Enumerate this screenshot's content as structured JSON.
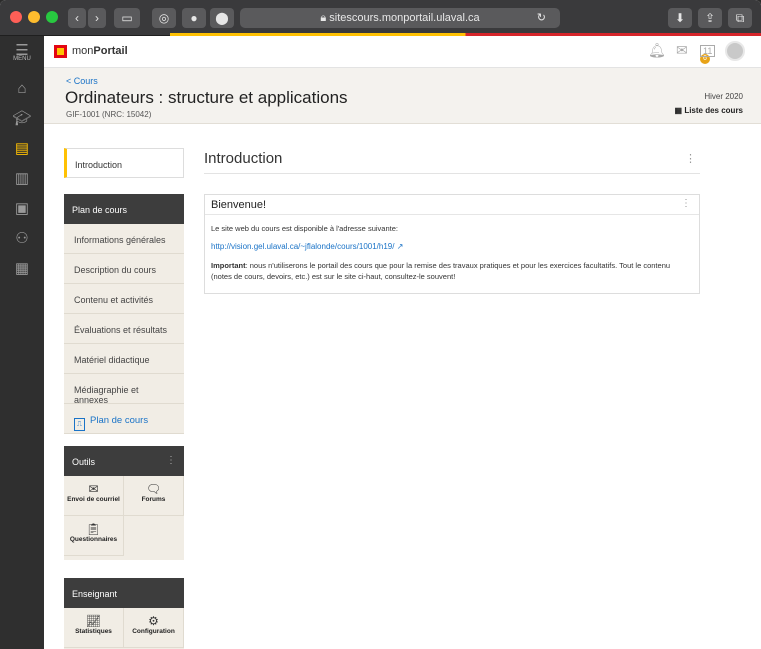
{
  "browser": {
    "url": "sitescours.monportail.ulaval.ca"
  },
  "rail": {
    "menu_label": "MENU"
  },
  "header": {
    "logo_prefix": "mon",
    "logo_bold": "Portail",
    "badge_count": "6",
    "calendar_day": "11"
  },
  "course": {
    "back_label": "< Cours",
    "title": "Ordinateurs : structure et applications",
    "code": "GIF-1001 (NRC: 15042)",
    "session": "Hiver 2020",
    "list_label": "Liste des cours"
  },
  "sidebar": {
    "intro_label": "Introduction",
    "plan_heading": "Plan de cours",
    "plan_items": [
      "Informations générales",
      "Description du cours",
      "Contenu et activités",
      "Évaluations et résultats",
      "Matériel didactique",
      "Médiagraphie et annexes"
    ],
    "plan_pdf_label": "Plan de cours",
    "tools_heading": "Outils",
    "tools": [
      "Envoi de courriel",
      "Forums",
      "Questionnaires"
    ],
    "teacher_heading": "Enseignant",
    "teacher_tools": [
      "Statistiques",
      "Configuration"
    ]
  },
  "main": {
    "title": "Introduction",
    "card_title": "Bienvenue!",
    "line1": "Le site web du cours est disponible à l'adresse suivante:",
    "link": "http://vision.gel.ulaval.ca/~jflalonde/cours/1001/h19/",
    "para_bold": "Important",
    "para_rest": ": nous n'utiliserons le portail des cours que pour la remise des travaux pratiques et pour les exercices facultatifs. Tout le contenu (notes de cours, devoirs, etc.) est sur le site ci-haut, consultez-le souvent!"
  }
}
